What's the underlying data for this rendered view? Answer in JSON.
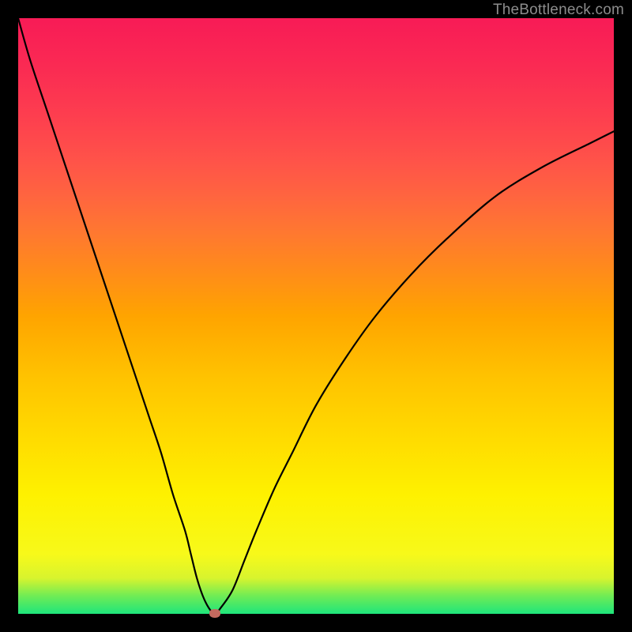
{
  "watermark": "TheBottleneck.com",
  "chart_data": {
    "type": "line",
    "title": "",
    "xlabel": "",
    "ylabel": "",
    "xlim": [
      0,
      100
    ],
    "ylim": [
      0,
      100
    ],
    "grid": false,
    "series": [
      {
        "name": "bottleneck-curve",
        "x": [
          0,
          2,
          5,
          8,
          11,
          14,
          17,
          20,
          22,
          24,
          26,
          28,
          29,
          30,
          31,
          32,
          33,
          34,
          36,
          38,
          40,
          43,
          46,
          50,
          55,
          60,
          66,
          72,
          80,
          88,
          96,
          100
        ],
        "values": [
          100,
          93,
          84,
          75,
          66,
          57,
          48,
          39,
          33,
          27,
          20,
          14,
          10,
          6,
          3,
          1,
          0,
          1,
          4,
          9,
          14,
          21,
          27,
          35,
          43,
          50,
          57,
          63,
          70,
          75,
          79,
          81
        ]
      }
    ],
    "annotations": [
      {
        "name": "min-marker",
        "x": 33,
        "y": 0
      }
    ],
    "colors": {
      "curve": "#000000",
      "marker": "#c36a5f",
      "gradient_top": "#f81b56",
      "gradient_bottom": "#1ee57c"
    }
  }
}
